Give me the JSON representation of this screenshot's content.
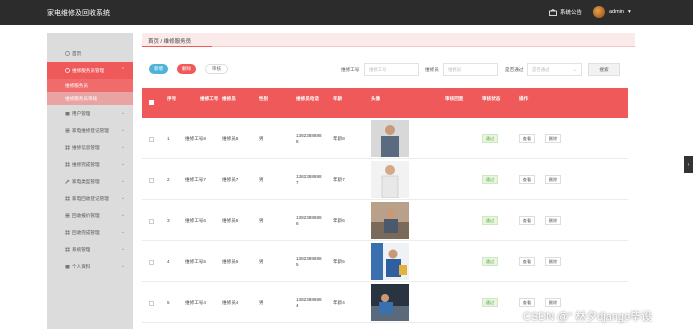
{
  "app": {
    "title": "家电维修及回收系统",
    "notice_label": "系统公告",
    "user_label": "admin",
    "user_caret": "▾"
  },
  "breadcrumb": "首页 / 维修服务员",
  "sidebar": {
    "items": [
      {
        "label": "首页",
        "icon": "circle-icon",
        "active": false,
        "chevron": false
      },
      {
        "label": "维修服务员管理",
        "icon": "circle-icon",
        "active": true,
        "chevron": true,
        "children": [
          "维修服务员",
          "维修服务员审核"
        ]
      },
      {
        "label": "用户管理",
        "icon": "folder-icon",
        "active": false,
        "chevron": true
      },
      {
        "label": "家电维修登记管理",
        "icon": "list-icon",
        "active": false,
        "chevron": true
      },
      {
        "label": "维修信息管理",
        "icon": "grid-icon",
        "active": false,
        "chevron": true
      },
      {
        "label": "维修完成管理",
        "icon": "grid-icon",
        "active": false,
        "chevron": true
      },
      {
        "label": "家电类型管理",
        "icon": "tool-icon",
        "active": false,
        "chevron": true
      },
      {
        "label": "家电回收登记管理",
        "icon": "grid-icon",
        "active": false,
        "chevron": true
      },
      {
        "label": "回收报价管理",
        "icon": "list-icon",
        "active": false,
        "chevron": true
      },
      {
        "label": "回收完成管理",
        "icon": "grid-icon",
        "active": false,
        "chevron": true
      },
      {
        "label": "系统管理",
        "icon": "grid-icon",
        "active": false,
        "chevron": true
      },
      {
        "label": "个人资料",
        "icon": "folder-icon",
        "active": false,
        "chevron": true
      }
    ]
  },
  "toolbar": {
    "add_label": "新增",
    "delete_label": "删除",
    "audit_label": "审核"
  },
  "filters": {
    "worker_no_label": "维修工号",
    "worker_no_placeholder": "维修工号",
    "name_label": "维修员",
    "name_placeholder": "维修员",
    "approved_label": "是否通过",
    "approved_placeholder": "是否通过",
    "search_label": "搜索"
  },
  "table": {
    "headers": [
      "序号",
      "维修工号",
      "维修员",
      "性别",
      "维修员电话",
      "年龄",
      "头像",
      "审核回复",
      "审核状态",
      "操作"
    ],
    "rows": [
      {
        "index": "1",
        "worker_no": "维修工号8",
        "name": "维修员8",
        "gender": "男",
        "phone": "13823888888",
        "age": "年龄8",
        "reply": "",
        "status": "通过"
      },
      {
        "index": "2",
        "worker_no": "维修工号7",
        "name": "维修员7",
        "gender": "男",
        "phone": "13823888887",
        "age": "年龄7",
        "reply": "",
        "status": "通过"
      },
      {
        "index": "3",
        "worker_no": "维修工号6",
        "name": "维修员6",
        "gender": "男",
        "phone": "13823888886",
        "age": "年龄6",
        "reply": "",
        "status": "通过"
      },
      {
        "index": "4",
        "worker_no": "维修工号5",
        "name": "维修员5",
        "gender": "男",
        "phone": "13823888885",
        "age": "年龄5",
        "reply": "",
        "status": "通过"
      },
      {
        "index": "5",
        "worker_no": "维修工号4",
        "name": "维修员4",
        "gender": "男",
        "phone": "13823888884",
        "age": "年龄4",
        "reply": "",
        "status": "通过"
      }
    ],
    "view_label": "查看",
    "delete_label": "删除"
  },
  "watermark": "CSDN @“ 林夕django毕设",
  "colors": {
    "accent": "#f0595a",
    "topbar": "#2c2c2c",
    "info": "#4fb3d9",
    "success": "#5aa53a"
  }
}
